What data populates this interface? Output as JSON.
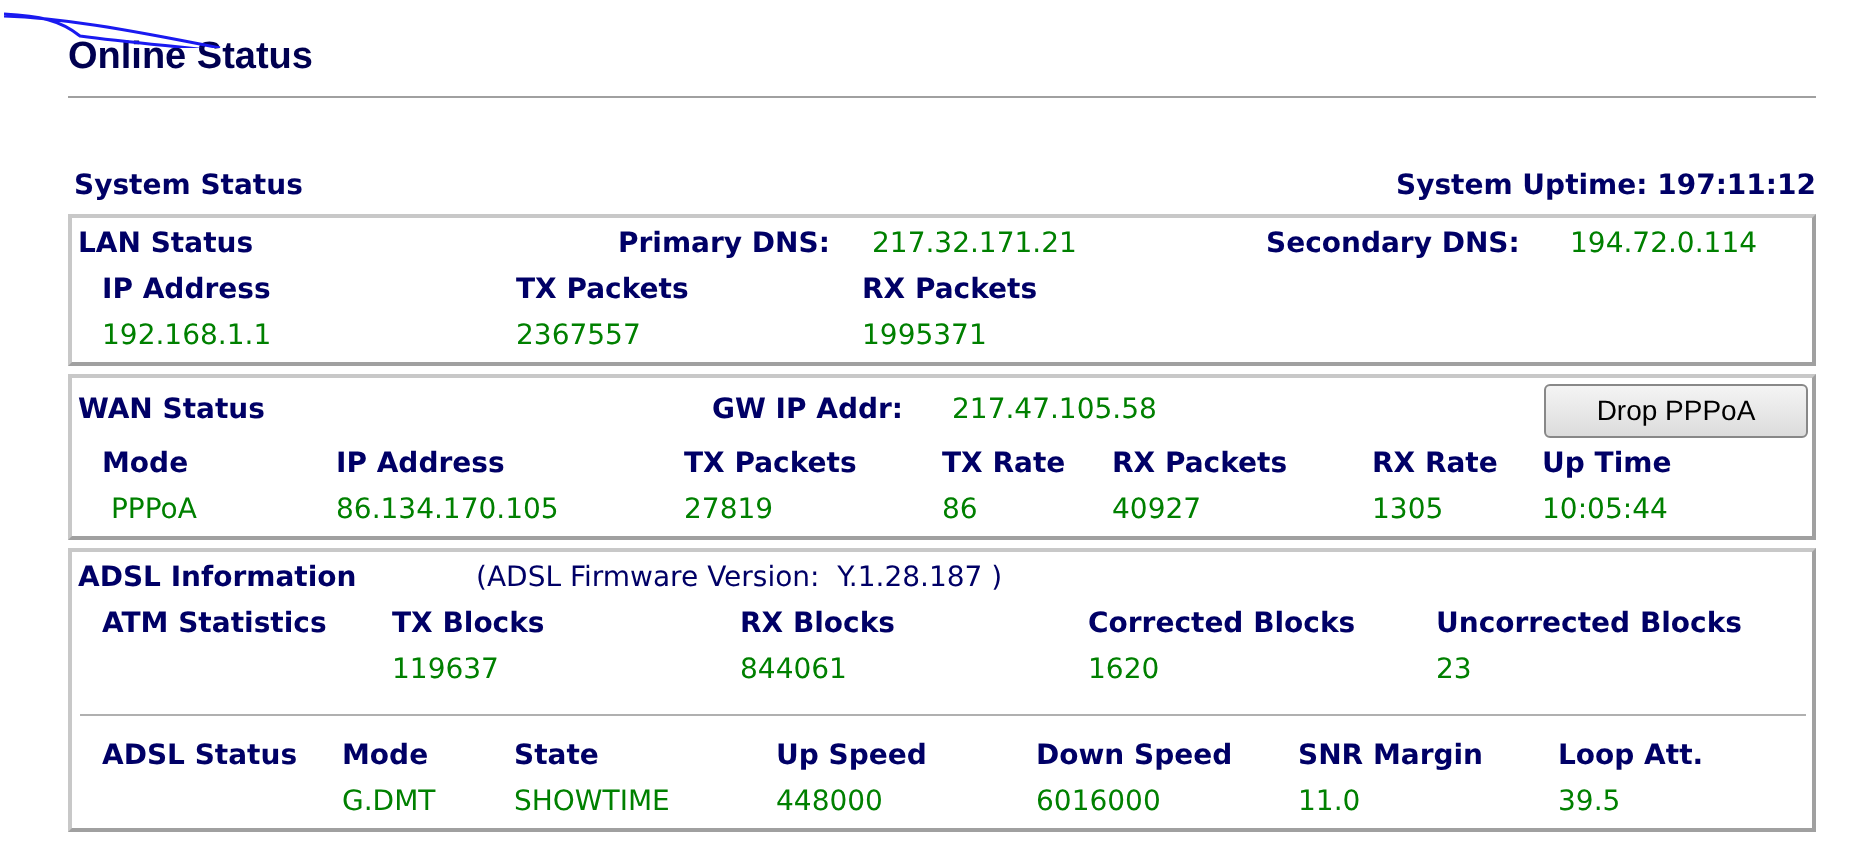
{
  "page": {
    "title": "Online Status"
  },
  "system_status": {
    "title": "System Status",
    "uptime": "System Uptime: 197:11:12"
  },
  "lan": {
    "title": "LAN Status",
    "primary_dns_label": "Primary DNS:",
    "primary_dns": "217.32.171.21",
    "secondary_dns_label": "Secondary DNS:",
    "secondary_dns": "194.72.0.114",
    "columns": [
      "IP Address",
      "TX Packets",
      "RX Packets"
    ],
    "values": [
      "192.168.1.1",
      "2367557",
      "1995371"
    ]
  },
  "wan": {
    "title": "WAN Status",
    "gw_label": "GW IP Addr:",
    "gw": "217.47.105.58",
    "button": "Drop PPPoA",
    "columns": [
      "Mode",
      "IP Address",
      "TX Packets",
      "TX Rate",
      "RX Packets",
      "RX Rate",
      "Up Time"
    ],
    "values": [
      " PPPoA",
      "86.134.170.105",
      "27819",
      "86",
      "40927",
      "1305",
      "10:05:44"
    ]
  },
  "adsl": {
    "title": "ADSL Information",
    "firmware": "(ADSL Firmware Version:  Y.1.28.187 )",
    "atm": {
      "label": "ATM Statistics",
      "columns": [
        "TX Blocks",
        "RX Blocks",
        "Corrected Blocks",
        "Uncorrected Blocks"
      ],
      "values": [
        "119637",
        "844061",
        "1620",
        "23"
      ]
    },
    "status": {
      "label": "ADSL Status",
      "columns": [
        "Mode",
        "State",
        "Up Speed",
        "Down Speed",
        "SNR Margin",
        "Loop Att."
      ],
      "values": [
        "G.DMT",
        "SHOWTIME",
        "448000",
        "6016000",
        "11.0",
        "39.5"
      ]
    }
  }
}
